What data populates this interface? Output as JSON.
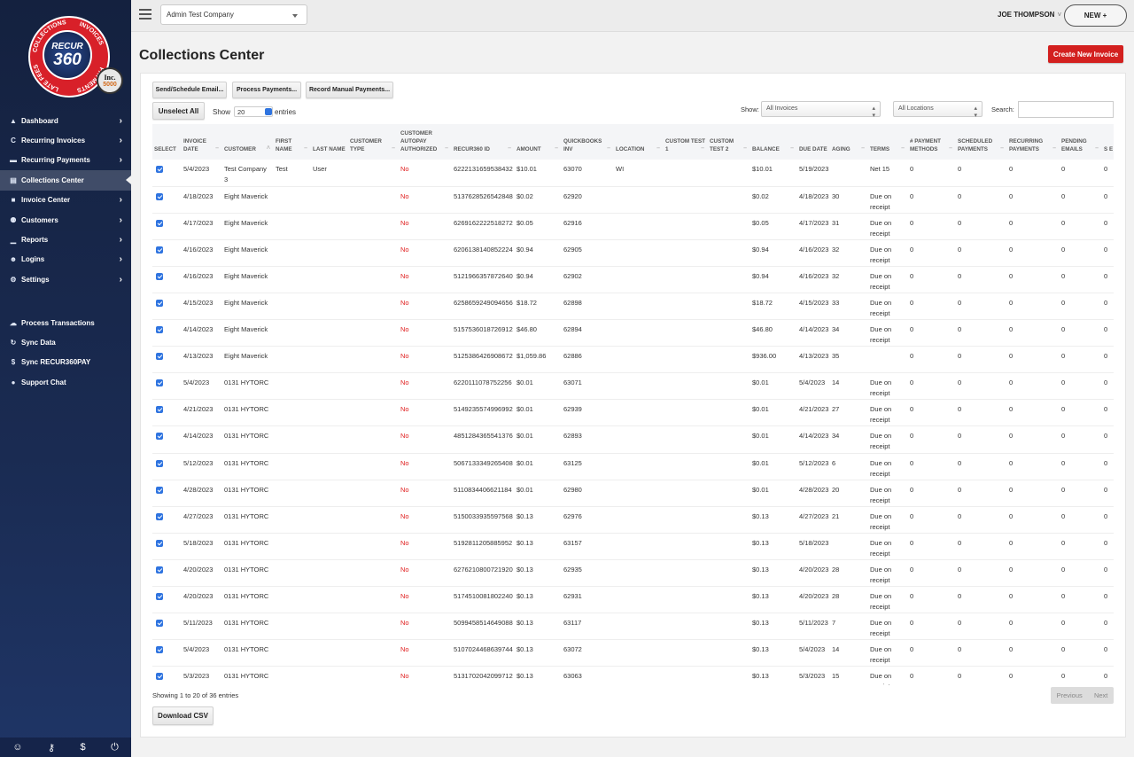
{
  "brand": {
    "logo_top": "RECUR",
    "logo_bottom": "360",
    "ring_words": [
      "INVOICES",
      "PAYMENTS",
      "LATE FEES",
      "COLLECTIONS"
    ],
    "badge_top": "Inc.",
    "badge_bottom": "5000",
    "accent_red": "#d3201f",
    "checkbox_blue": "#2f74e0"
  },
  "sidebar": {
    "items": [
      {
        "label": "Dashboard",
        "icon": "dashboard-icon",
        "glyph": "▲"
      },
      {
        "label": "Recurring Invoices",
        "icon": "refresh-icon",
        "glyph": "C"
      },
      {
        "label": "Recurring Payments",
        "icon": "credit-card-icon",
        "glyph": "▬"
      },
      {
        "label": "Collections Center",
        "icon": "document-icon",
        "glyph": "▤"
      },
      {
        "label": "Invoice Center",
        "icon": "file-icon",
        "glyph": "■"
      },
      {
        "label": "Customers",
        "icon": "users-icon",
        "glyph": "⚉"
      },
      {
        "label": "Reports",
        "icon": "chart-icon",
        "glyph": "▁"
      },
      {
        "label": "Logins",
        "icon": "user-key-icon",
        "glyph": "☻"
      },
      {
        "label": "Settings",
        "icon": "gears-icon",
        "glyph": "⚙"
      }
    ],
    "active_index": 3,
    "secondary_items": [
      {
        "label": "Process Transactions",
        "icon": "cloud-icon",
        "glyph": "☁"
      },
      {
        "label": "Sync Data",
        "icon": "sync-icon",
        "glyph": "↻"
      },
      {
        "label": "Sync RECUR360PAY",
        "icon": "dollar-icon",
        "glyph": "$"
      },
      {
        "label": "Support Chat",
        "icon": "chat-icon",
        "glyph": "●"
      }
    ],
    "footer_icons": [
      {
        "name": "user-icon",
        "glyph": "☺"
      },
      {
        "name": "key-icon",
        "glyph": "⚷"
      },
      {
        "name": "dollar-icon",
        "glyph": "$"
      },
      {
        "name": "power-icon",
        "glyph": "⏻"
      }
    ]
  },
  "topbar": {
    "company": "Admin Test Company",
    "user_name": "JOE THOMPSON",
    "user_chevron": "˅",
    "new_label": "NEW +"
  },
  "page": {
    "title": "Collections Center",
    "create_label": "Create New Invoice"
  },
  "toolbar": {
    "send_email": "Send/Schedule Email...",
    "process_payments": "Process Payments...",
    "record_manual": "Record Manual Payments...",
    "unselect_all": "Unselect All",
    "show_label": "Show",
    "entries_value": "20",
    "entries_label": "entries",
    "filter_show_label": "Show:",
    "invoice_filter": "All Invoices",
    "location_filter": "All Locations",
    "search_label": "Search:",
    "search_value": ""
  },
  "table": {
    "columns": [
      "Select",
      "Invoice Date",
      "Customer",
      "First Name",
      "Last Name",
      "Customer Type",
      "Customer Autopay Authorized",
      "Recur360 ID",
      "Amount",
      "QuickBooks Inv",
      "Location",
      "Custom Test 1",
      "Custom Test 2",
      "Balance",
      "Due Date",
      "Aging",
      "Terms",
      "# Payment Methods",
      "Scheduled Payments",
      "Recurring Payments",
      "Pending Emails",
      "S E"
    ],
    "sorted_column": "Customer",
    "rows": [
      {
        "date": "5/4/2023",
        "customer": "Test Company 3",
        "first": "Test",
        "last": "User",
        "type": "",
        "autopay": "No",
        "id": "6222131659538432",
        "amount": "$10.01",
        "qb": "63070",
        "location": "WI",
        "c1": "",
        "c2": "",
        "balance": "$10.01",
        "due": "5/19/2023",
        "aging": "",
        "terms": "Net 15",
        "pm": "0",
        "sp": "0",
        "rp": "0",
        "pe": "0",
        "se": "0"
      },
      {
        "date": "4/18/2023",
        "customer": "Eight Maverick",
        "first": "",
        "last": "",
        "type": "",
        "autopay": "No",
        "id": "5137628526542848",
        "amount": "$0.02",
        "qb": "62920",
        "location": "",
        "c1": "",
        "c2": "",
        "balance": "$0.02",
        "due": "4/18/2023",
        "aging": "30",
        "terms": "Due on receipt",
        "pm": "0",
        "sp": "0",
        "rp": "0",
        "pe": "0",
        "se": "0"
      },
      {
        "date": "4/17/2023",
        "customer": "Eight Maverick",
        "first": "",
        "last": "",
        "type": "",
        "autopay": "No",
        "id": "6269162222518272",
        "amount": "$0.05",
        "qb": "62916",
        "location": "",
        "c1": "",
        "c2": "",
        "balance": "$0.05",
        "due": "4/17/2023",
        "aging": "31",
        "terms": "Due on receipt",
        "pm": "0",
        "sp": "0",
        "rp": "0",
        "pe": "0",
        "se": "0"
      },
      {
        "date": "4/16/2023",
        "customer": "Eight Maverick",
        "first": "",
        "last": "",
        "type": "",
        "autopay": "No",
        "id": "6206138140852224",
        "amount": "$0.94",
        "qb": "62905",
        "location": "",
        "c1": "",
        "c2": "",
        "balance": "$0.94",
        "due": "4/16/2023",
        "aging": "32",
        "terms": "Due on receipt",
        "pm": "0",
        "sp": "0",
        "rp": "0",
        "pe": "0",
        "se": "0"
      },
      {
        "date": "4/16/2023",
        "customer": "Eight Maverick",
        "first": "",
        "last": "",
        "type": "",
        "autopay": "No",
        "id": "5121966357872640",
        "amount": "$0.94",
        "qb": "62902",
        "location": "",
        "c1": "",
        "c2": "",
        "balance": "$0.94",
        "due": "4/16/2023",
        "aging": "32",
        "terms": "Due on receipt",
        "pm": "0",
        "sp": "0",
        "rp": "0",
        "pe": "0",
        "se": "0"
      },
      {
        "date": "4/15/2023",
        "customer": "Eight Maverick",
        "first": "",
        "last": "",
        "type": "",
        "autopay": "No",
        "id": "6258659249094656",
        "amount": "$18.72",
        "qb": "62898",
        "location": "",
        "c1": "",
        "c2": "",
        "balance": "$18.72",
        "due": "4/15/2023",
        "aging": "33",
        "terms": "Due on receipt",
        "pm": "0",
        "sp": "0",
        "rp": "0",
        "pe": "0",
        "se": "0"
      },
      {
        "date": "4/14/2023",
        "customer": "Eight Maverick",
        "first": "",
        "last": "",
        "type": "",
        "autopay": "No",
        "id": "5157536018726912",
        "amount": "$46.80",
        "qb": "62894",
        "location": "",
        "c1": "",
        "c2": "",
        "balance": "$46.80",
        "due": "4/14/2023",
        "aging": "34",
        "terms": "Due on receipt",
        "pm": "0",
        "sp": "0",
        "rp": "0",
        "pe": "0",
        "se": "0"
      },
      {
        "date": "4/13/2023",
        "customer": "Eight Maverick",
        "first": "",
        "last": "",
        "type": "",
        "autopay": "No",
        "id": "5125386426908672",
        "amount": "$1,059.86",
        "qb": "62886",
        "location": "",
        "c1": "",
        "c2": "",
        "balance": "$936.00",
        "due": "4/13/2023",
        "aging": "35",
        "terms": "",
        "pm": "0",
        "sp": "0",
        "rp": "0",
        "pe": "0",
        "se": "0"
      },
      {
        "date": "5/4/2023",
        "customer": "0131 HYTORC",
        "first": "",
        "last": "",
        "type": "",
        "autopay": "No",
        "id": "6220111078752256",
        "amount": "$0.01",
        "qb": "63071",
        "location": "",
        "c1": "",
        "c2": "",
        "balance": "$0.01",
        "due": "5/4/2023",
        "aging": "14",
        "terms": "Due on receipt",
        "pm": "0",
        "sp": "0",
        "rp": "0",
        "pe": "0",
        "se": "0"
      },
      {
        "date": "4/21/2023",
        "customer": "0131 HYTORC",
        "first": "",
        "last": "",
        "type": "",
        "autopay": "No",
        "id": "5149235574996992",
        "amount": "$0.01",
        "qb": "62939",
        "location": "",
        "c1": "",
        "c2": "",
        "balance": "$0.01",
        "due": "4/21/2023",
        "aging": "27",
        "terms": "Due on receipt",
        "pm": "0",
        "sp": "0",
        "rp": "0",
        "pe": "0",
        "se": "0"
      },
      {
        "date": "4/14/2023",
        "customer": "0131 HYTORC",
        "first": "",
        "last": "",
        "type": "",
        "autopay": "No",
        "id": "4851284365541376",
        "amount": "$0.01",
        "qb": "62893",
        "location": "",
        "c1": "",
        "c2": "",
        "balance": "$0.01",
        "due": "4/14/2023",
        "aging": "34",
        "terms": "Due on receipt",
        "pm": "0",
        "sp": "0",
        "rp": "0",
        "pe": "0",
        "se": "0"
      },
      {
        "date": "5/12/2023",
        "customer": "0131 HYTORC",
        "first": "",
        "last": "",
        "type": "",
        "autopay": "No",
        "id": "5067133349265408",
        "amount": "$0.01",
        "qb": "63125",
        "location": "",
        "c1": "",
        "c2": "",
        "balance": "$0.01",
        "due": "5/12/2023",
        "aging": "6",
        "terms": "Due on receipt",
        "pm": "0",
        "sp": "0",
        "rp": "0",
        "pe": "0",
        "se": "0"
      },
      {
        "date": "4/28/2023",
        "customer": "0131 HYTORC",
        "first": "",
        "last": "",
        "type": "",
        "autopay": "No",
        "id": "5110834406621184",
        "amount": "$0.01",
        "qb": "62980",
        "location": "",
        "c1": "",
        "c2": "",
        "balance": "$0.01",
        "due": "4/28/2023",
        "aging": "20",
        "terms": "Due on receipt",
        "pm": "0",
        "sp": "0",
        "rp": "0",
        "pe": "0",
        "se": "0"
      },
      {
        "date": "4/27/2023",
        "customer": "0131 HYTORC",
        "first": "",
        "last": "",
        "type": "",
        "autopay": "No",
        "id": "5150033935597568",
        "amount": "$0.13",
        "qb": "62976",
        "location": "",
        "c1": "",
        "c2": "",
        "balance": "$0.13",
        "due": "4/27/2023",
        "aging": "21",
        "terms": "Due on receipt",
        "pm": "0",
        "sp": "0",
        "rp": "0",
        "pe": "0",
        "se": "0"
      },
      {
        "date": "5/18/2023",
        "customer": "0131 HYTORC",
        "first": "",
        "last": "",
        "type": "",
        "autopay": "No",
        "id": "5192811205885952",
        "amount": "$0.13",
        "qb": "63157",
        "location": "",
        "c1": "",
        "c2": "",
        "balance": "$0.13",
        "due": "5/18/2023",
        "aging": "",
        "terms": "Due on receipt",
        "pm": "0",
        "sp": "0",
        "rp": "0",
        "pe": "0",
        "se": "0"
      },
      {
        "date": "4/20/2023",
        "customer": "0131 HYTORC",
        "first": "",
        "last": "",
        "type": "",
        "autopay": "No",
        "id": "6276210800721920",
        "amount": "$0.13",
        "qb": "62935",
        "location": "",
        "c1": "",
        "c2": "",
        "balance": "$0.13",
        "due": "4/20/2023",
        "aging": "28",
        "terms": "Due on receipt",
        "pm": "0",
        "sp": "0",
        "rp": "0",
        "pe": "0",
        "se": "0"
      },
      {
        "date": "4/20/2023",
        "customer": "0131 HYTORC",
        "first": "",
        "last": "",
        "type": "",
        "autopay": "No",
        "id": "5174510081802240",
        "amount": "$0.13",
        "qb": "62931",
        "location": "",
        "c1": "",
        "c2": "",
        "balance": "$0.13",
        "due": "4/20/2023",
        "aging": "28",
        "terms": "Due on receipt",
        "pm": "0",
        "sp": "0",
        "rp": "0",
        "pe": "0",
        "se": "0"
      },
      {
        "date": "5/11/2023",
        "customer": "0131 HYTORC",
        "first": "",
        "last": "",
        "type": "",
        "autopay": "No",
        "id": "5099458514649088",
        "amount": "$0.13",
        "qb": "63117",
        "location": "",
        "c1": "",
        "c2": "",
        "balance": "$0.13",
        "due": "5/11/2023",
        "aging": "7",
        "terms": "Due on receipt",
        "pm": "0",
        "sp": "0",
        "rp": "0",
        "pe": "0",
        "se": "0"
      },
      {
        "date": "5/4/2023",
        "customer": "0131 HYTORC",
        "first": "",
        "last": "",
        "type": "",
        "autopay": "No",
        "id": "5107024468639744",
        "amount": "$0.13",
        "qb": "63072",
        "location": "",
        "c1": "",
        "c2": "",
        "balance": "$0.13",
        "due": "5/4/2023",
        "aging": "14",
        "terms": "Due on receipt",
        "pm": "0",
        "sp": "0",
        "rp": "0",
        "pe": "0",
        "se": "0"
      },
      {
        "date": "5/3/2023",
        "customer": "0131 HYTORC",
        "first": "",
        "last": "",
        "type": "",
        "autopay": "No",
        "id": "5131702042099712",
        "amount": "$0.13",
        "qb": "63063",
        "location": "",
        "c1": "",
        "c2": "",
        "balance": "$0.13",
        "due": "5/3/2023",
        "aging": "15",
        "terms": "Due on receipt",
        "pm": "0",
        "sp": "0",
        "rp": "0",
        "pe": "0",
        "se": "0"
      }
    ]
  },
  "footer": {
    "showing": "Showing 1 to 20 of 36 entries",
    "download_csv": "Download CSV",
    "previous": "Previous",
    "next": "Next"
  }
}
